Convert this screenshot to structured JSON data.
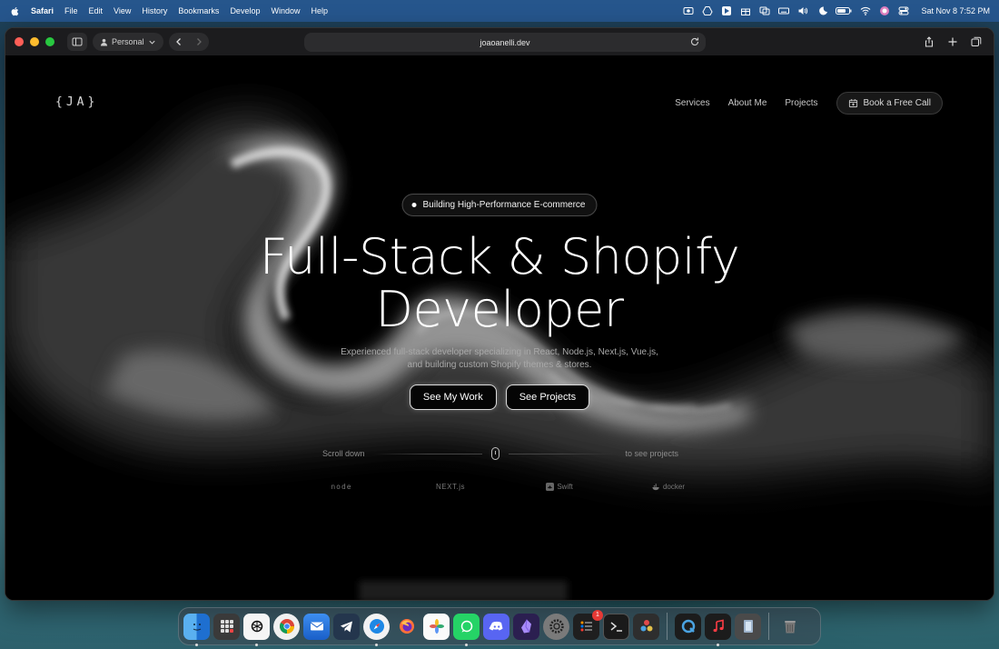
{
  "menubar": {
    "items": [
      "Safari",
      "File",
      "Edit",
      "View",
      "History",
      "Bookmarks",
      "Develop",
      "Window",
      "Help"
    ],
    "status_icons": [
      "camera-icon",
      "drive-icon",
      "cursor-app-icon",
      "gift-icon",
      "mirror-icon",
      "keyboard-icon",
      "volume-icon",
      "moon-icon",
      "battery-icon",
      "wifi-icon",
      "siri-icon",
      "control-center-icon"
    ],
    "datetime": "Sat Nov 8  7:52 PM"
  },
  "browser": {
    "profile_label": "Personal",
    "url": "joaoanelli.dev"
  },
  "site": {
    "logo": "{JA}",
    "nav": [
      "Services",
      "About Me",
      "Projects"
    ],
    "cta_label": "Book a Free Call",
    "badge": "Building High-Performance E-commerce",
    "headline_line1": "Full-Stack & Shopify",
    "headline_line2": "Developer",
    "subtitle_line1": "Experienced full-stack developer specializing in React, Node.js, Next.js, Vue.js,",
    "subtitle_line2": "and building custom Shopify themes & stores.",
    "primary_button": "See My Work",
    "secondary_button": "See Projects",
    "scroll_left": "Scroll down",
    "scroll_right": "to see projects",
    "tech_logos": [
      "node",
      "NEXT.js",
      "Swift",
      "docker"
    ]
  },
  "dock": {
    "apps": [
      {
        "name": "finder",
        "color": "#1e88e5"
      },
      {
        "name": "launchpad",
        "color": "#444"
      },
      {
        "name": "chatgpt",
        "color": "#f5f5f5"
      },
      {
        "name": "chrome",
        "color": "#f5f5f5"
      },
      {
        "name": "mail",
        "color": "#1565c0"
      },
      {
        "name": "telegram",
        "color": "#2a2a3a"
      },
      {
        "name": "safari",
        "color": "#1976d2"
      },
      {
        "name": "firefox",
        "color": "#6a1b9a"
      },
      {
        "name": "photos",
        "color": "#f5f5f5"
      },
      {
        "name": "whatsapp",
        "color": "#25d366"
      },
      {
        "name": "discord",
        "color": "#5865f2"
      },
      {
        "name": "obsidian",
        "color": "#3b2e6e"
      },
      {
        "name": "system-settings",
        "color": "#666"
      },
      {
        "name": "reminders",
        "color": "#222",
        "badge": "1"
      },
      {
        "name": "terminal",
        "color": "#222"
      },
      {
        "name": "davinci-resolve",
        "color": "#333"
      },
      {
        "name": "quicktime",
        "color": "#222"
      },
      {
        "name": "music",
        "color": "#222"
      },
      {
        "name": "preview",
        "color": "#555"
      },
      {
        "name": "trash",
        "color": "transparent"
      }
    ]
  }
}
